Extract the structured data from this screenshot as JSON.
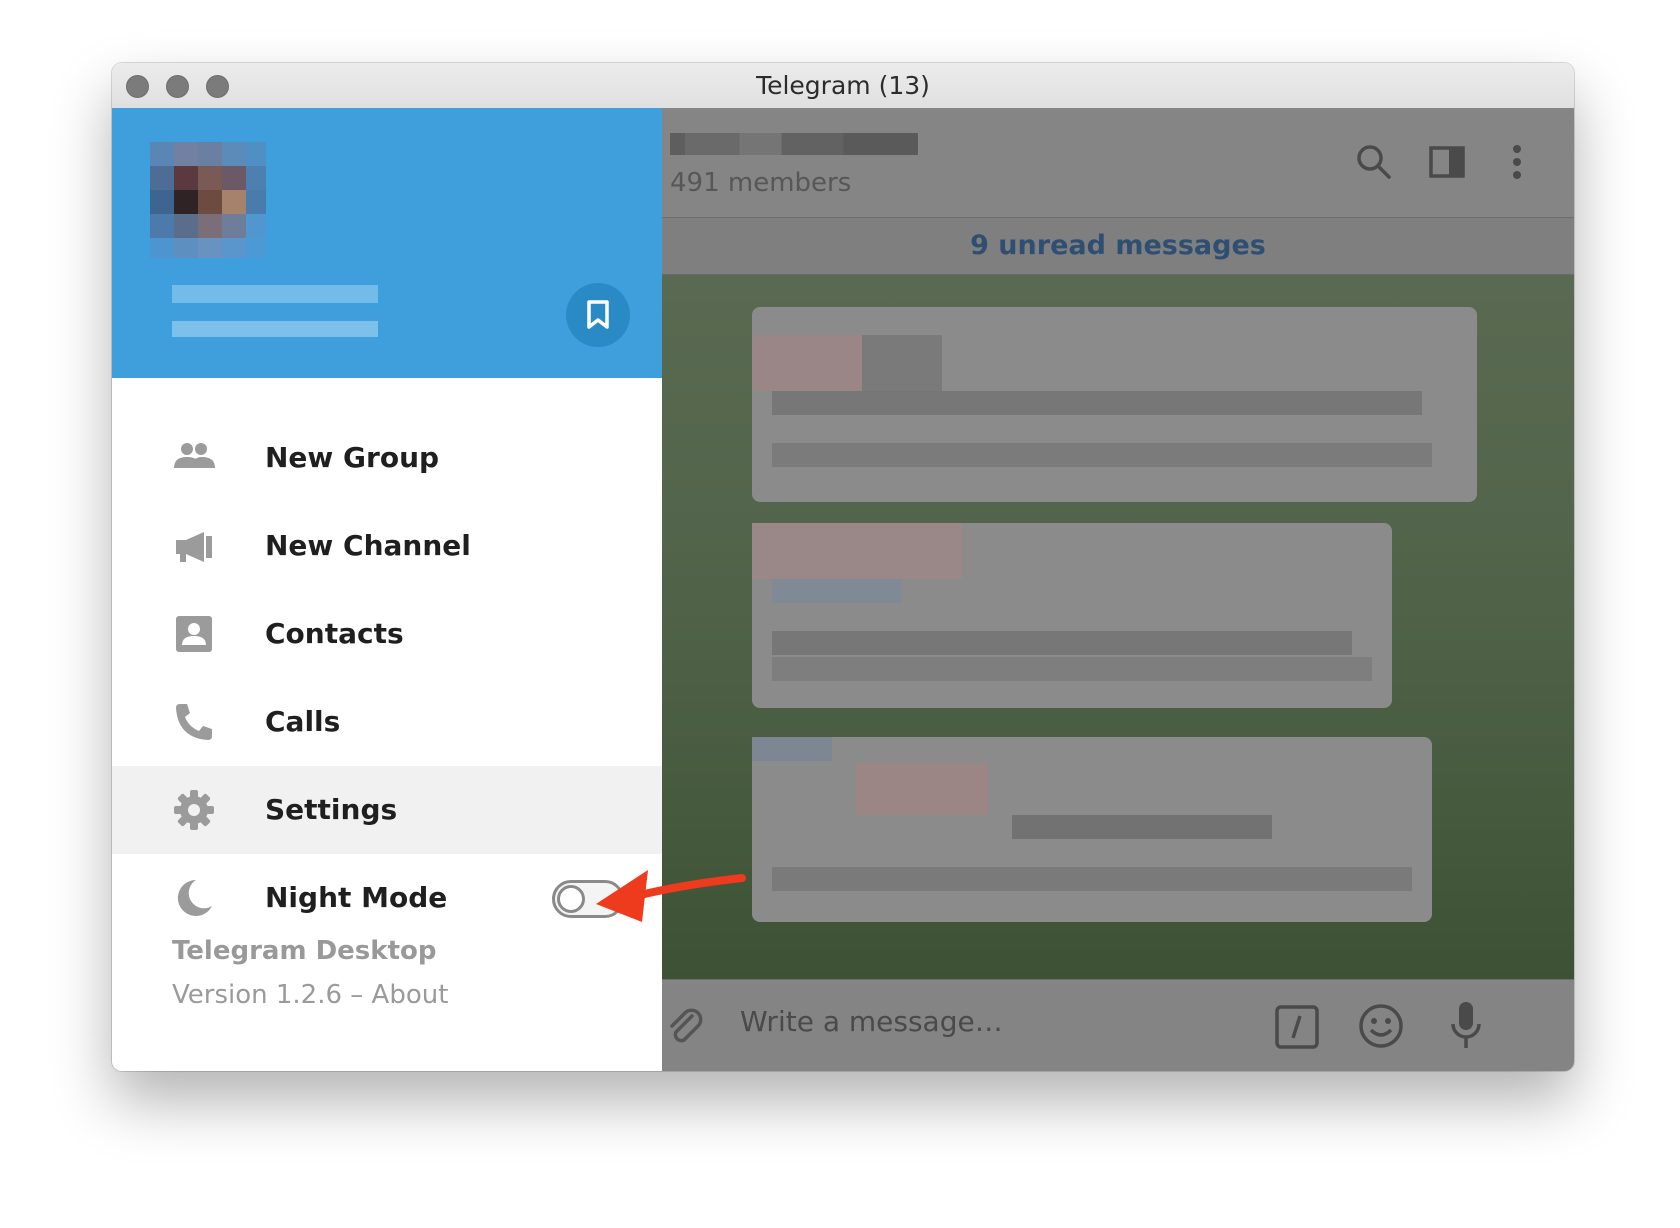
{
  "window": {
    "title": "Telegram (13)"
  },
  "chat": {
    "members": "491 members",
    "unread": "9 unread messages",
    "composer_placeholder": "Write a message…"
  },
  "drawer": {
    "menu": [
      {
        "label": "New Group",
        "icon": "group-icon"
      },
      {
        "label": "New Channel",
        "icon": "megaphone-icon"
      },
      {
        "label": "Contacts",
        "icon": "contact-card-icon"
      },
      {
        "label": "Calls",
        "icon": "phone-icon"
      },
      {
        "label": "Settings",
        "icon": "gear-icon"
      },
      {
        "label": "Night Mode",
        "icon": "moon-icon"
      }
    ],
    "night_mode_on": false,
    "footer_app": "Telegram Desktop",
    "footer_version": "Version 1.2.6 – About"
  },
  "colors": {
    "accent": "#3e9fdc",
    "annotation_arrow": "#ee3a1d"
  }
}
